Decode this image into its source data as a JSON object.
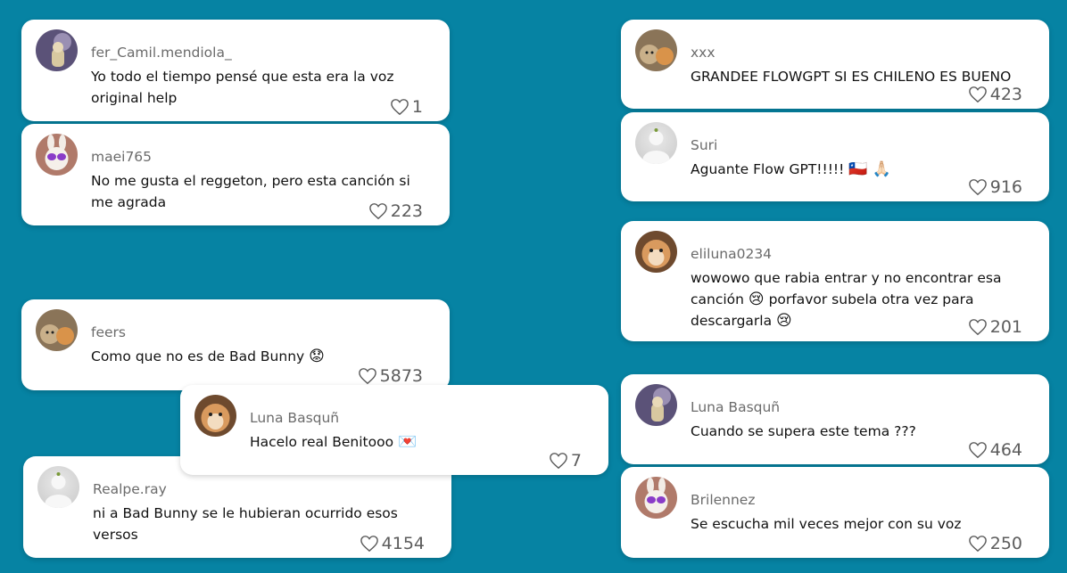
{
  "comments": [
    {
      "user": "fer_Camil.mendiola_",
      "text": "Yo todo el tiempo pensé que esta era la voz original help",
      "likes": "1",
      "avatar": "user-photo-avatar"
    },
    {
      "user": "maei765",
      "text": "No me gusta el reggeton, pero esta canción si me agrada",
      "likes": "223",
      "avatar": "bunny-avatar"
    },
    {
      "user": "feers",
      "text": "Como que no es de Bad Bunny",
      "emoji": "😟",
      "likes": "5873",
      "avatar": "cats-avatar"
    },
    {
      "user": "Luna Basquñ",
      "text": "Hacelo real Benitooo",
      "emoji": "💌",
      "likes": "7",
      "avatar": "hamster-avatar"
    },
    {
      "user": "Realpe.ray",
      "text": "ni a Bad Bunny se le hubieran ocurrido esos versos",
      "likes": "4154",
      "avatar": "default-avatar"
    },
    {
      "user": "xxx",
      "text": "GRANDEE FLOWGPT SI ES CHILENO ES BUENO",
      "likes": "423",
      "avatar": "cats-avatar"
    },
    {
      "user": "Suri",
      "text": "Aguante Flow GPT!!!!!",
      "emoji": "🇨🇱 🙏🏻",
      "likes": "916",
      "avatar": "default-avatar"
    },
    {
      "user": "eliluna0234",
      "text_parts": [
        "wowowo que rabia entrar y no encontrar esa canción ",
        "😢",
        " porfavor subela otra vez para descargarla ",
        "😢"
      ],
      "likes": "201",
      "avatar": "hamster-avatar"
    },
    {
      "user": "Luna Basquñ",
      "text": "Cuando se supera este tema ???",
      "likes": "464",
      "avatar": "user-photo-avatar"
    },
    {
      "user": "Brilennez",
      "text": "Se escucha mil veces mejor con su voz",
      "likes": "250",
      "avatar": "bunny-avatar"
    }
  ]
}
